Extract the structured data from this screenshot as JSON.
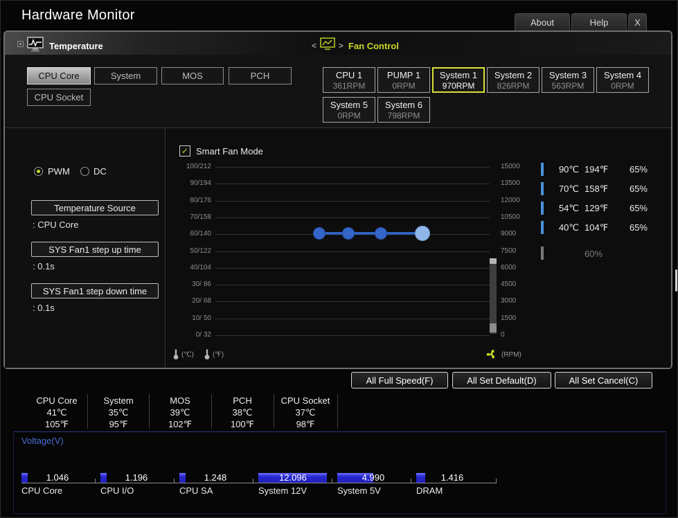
{
  "titlebar": {
    "title": "Hardware Monitor",
    "about": "About",
    "help": "Help",
    "close": "X"
  },
  "icons": {
    "check": "✓"
  },
  "temperature_panel": {
    "label": "Temperature",
    "tabs": [
      {
        "label": "CPU Core"
      },
      {
        "label": "System"
      },
      {
        "label": "MOS"
      },
      {
        "label": "PCH"
      },
      {
        "label": "CPU Socket"
      }
    ]
  },
  "fan_control": {
    "nav_left": "<",
    "nav_right": ">",
    "label": "Fan Control",
    "fans": [
      {
        "name": "CPU 1",
        "rpm": "361RPM"
      },
      {
        "name": "PUMP 1",
        "rpm": "0RPM"
      },
      {
        "name": "System 1",
        "rpm": "970RPM"
      },
      {
        "name": "System 2",
        "rpm": "826RPM"
      },
      {
        "name": "System 3",
        "rpm": "563RPM"
      },
      {
        "name": "System 4",
        "rpm": "0RPM"
      },
      {
        "name": "System 5",
        "rpm": "0RPM"
      },
      {
        "name": "System 6",
        "rpm": "798RPM"
      }
    ]
  },
  "left_controls": {
    "pwm": "PWM",
    "dc": "DC",
    "temp_source_label": "Temperature Source",
    "temp_source_value": ": CPU Core",
    "step_up_label": "SYS Fan1 step up time",
    "step_up_value": ": 0.1s",
    "step_down_label": "SYS Fan1 step down time",
    "step_down_value": ": 0.1s"
  },
  "smart_fan_label": "Smart Fan Mode",
  "chart_data": {
    "type": "line",
    "title": "Smart Fan Mode curve",
    "left_axis_ticks": [
      "100/212",
      "90/194",
      "80/176",
      "70/158",
      "60/140",
      "50/122",
      "40/104",
      "30/ 86",
      "20/ 68",
      "10/ 50",
      "0/ 32"
    ],
    "right_axis_ticks": [
      "15000",
      "13500",
      "12000",
      "10500",
      "9000",
      "7500",
      "6000",
      "4500",
      "3000",
      "1500",
      "0"
    ],
    "unit_celsius": "(℃)",
    "unit_fahrenheit": "(℉)",
    "unit_rpm": "(RPM)",
    "points": [
      {
        "temp_c": 40,
        "temp_f": 104,
        "duty_pct": 65
      },
      {
        "temp_c": 54,
        "temp_f": 129,
        "duty_pct": 65
      },
      {
        "temp_c": 70,
        "temp_f": 158,
        "duty_pct": 65
      },
      {
        "temp_c": 90,
        "temp_f": 194,
        "duty_pct": 65
      }
    ],
    "min_duty_pct": 60
  },
  "point_rows": [
    {
      "c": "90℃",
      "f": "194℉",
      "pct": "65%"
    },
    {
      "c": "70℃",
      "f": "158℉",
      "pct": "65%"
    },
    {
      "c": "54℃",
      "f": "129℉",
      "pct": "65%"
    },
    {
      "c": "40℃",
      "f": "104℉",
      "pct": "65%"
    }
  ],
  "min_row": {
    "pct": "60%"
  },
  "action_bar": {
    "full_speed": "All Full Speed(F)",
    "set_default": "All Set Default(D)",
    "set_cancel": "All Set Cancel(C)"
  },
  "temperature_readouts": [
    {
      "name": "CPU Core",
      "c": "41℃",
      "f": "105℉"
    },
    {
      "name": "System",
      "c": "35℃",
      "f": "95℉"
    },
    {
      "name": "MOS",
      "c": "39℃",
      "f": "102℉"
    },
    {
      "name": "PCH",
      "c": "38℃",
      "f": "100℉"
    },
    {
      "name": "CPU Socket",
      "c": "37℃",
      "f": "98℉"
    }
  ],
  "voltage": {
    "label": "Voltage(V)",
    "items": [
      {
        "name": "CPU Core",
        "value": "1.046"
      },
      {
        "name": "CPU I/O",
        "value": "1.196"
      },
      {
        "name": "CPU SA",
        "value": "1.248"
      },
      {
        "name": "System 12V",
        "value": "12.096"
      },
      {
        "name": "System 5V",
        "value": "4.990"
      },
      {
        "name": "DRAM",
        "value": "1.416"
      }
    ]
  },
  "colors": {
    "accent": "#c9d929",
    "point_blue": "#3565c8",
    "point_light": "#90b7e9",
    "voltage_bar_blue": "#2b2bdd",
    "voltage_label_blue": "#4a6fd8",
    "row_bar_blue": "#4a90d9"
  }
}
